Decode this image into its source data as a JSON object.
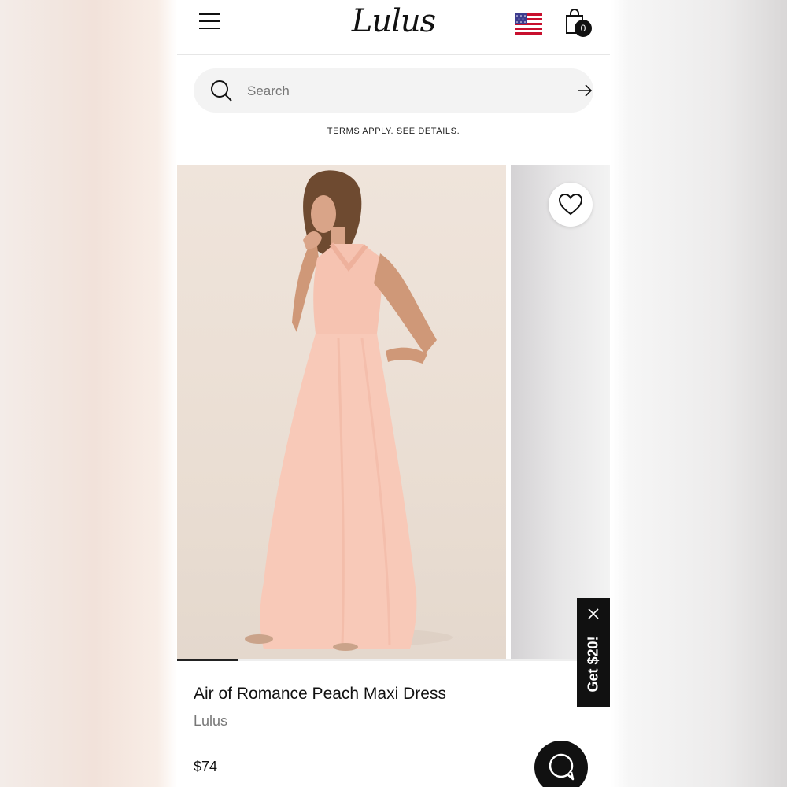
{
  "header": {
    "menu_icon": "hamburger-menu-icon",
    "logo_text": "Lulus",
    "flag_icon": "us-flag-icon",
    "cart_icon": "shopping-bag-icon",
    "cart_count": "0"
  },
  "search": {
    "placeholder": "Search",
    "value": "",
    "icon": "search-icon",
    "submit_icon": "arrow-right-icon"
  },
  "terms": {
    "text": "TERMS APPLY. ",
    "link": "SEE DETAILS",
    "suffix": "."
  },
  "gallery": {
    "favorite_icon": "heart-icon",
    "progress_fraction": 0.14
  },
  "product": {
    "name": "Air of Romance Peach Maxi Dress",
    "brand": "Lulus",
    "price": "$74"
  },
  "promo": {
    "label": "Get $20!",
    "close_icon": "close-icon"
  },
  "chat": {
    "icon": "chat-bubble-icon"
  },
  "colors": {
    "dress": "#f8c9b8",
    "background": "#efe4db",
    "dark": "#111111"
  }
}
